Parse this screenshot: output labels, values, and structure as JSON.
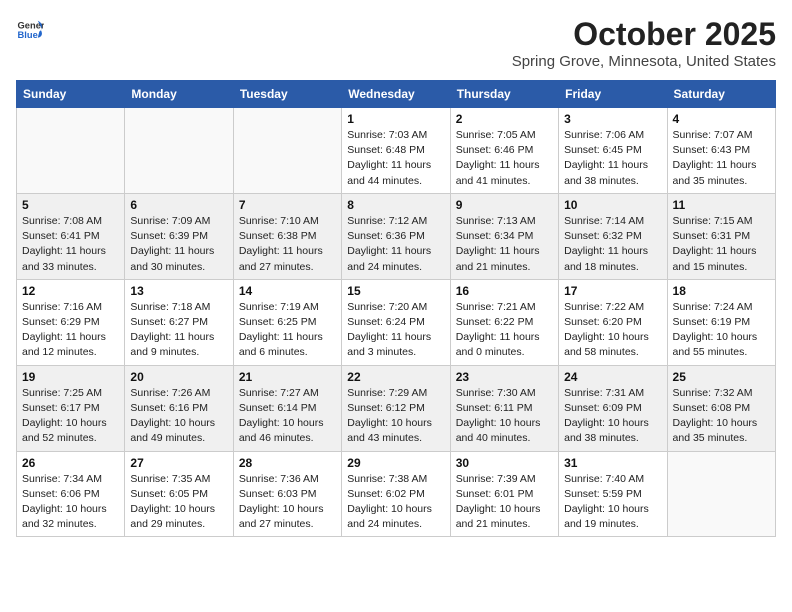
{
  "header": {
    "logo_general": "General",
    "logo_blue": "Blue",
    "month": "October 2025",
    "location": "Spring Grove, Minnesota, United States"
  },
  "weekdays": [
    "Sunday",
    "Monday",
    "Tuesday",
    "Wednesday",
    "Thursday",
    "Friday",
    "Saturday"
  ],
  "weeks": [
    [
      {
        "day": "",
        "info": ""
      },
      {
        "day": "",
        "info": ""
      },
      {
        "day": "",
        "info": ""
      },
      {
        "day": "1",
        "info": "Sunrise: 7:03 AM\nSunset: 6:48 PM\nDaylight: 11 hours\nand 44 minutes."
      },
      {
        "day": "2",
        "info": "Sunrise: 7:05 AM\nSunset: 6:46 PM\nDaylight: 11 hours\nand 41 minutes."
      },
      {
        "day": "3",
        "info": "Sunrise: 7:06 AM\nSunset: 6:45 PM\nDaylight: 11 hours\nand 38 minutes."
      },
      {
        "day": "4",
        "info": "Sunrise: 7:07 AM\nSunset: 6:43 PM\nDaylight: 11 hours\nand 35 minutes."
      }
    ],
    [
      {
        "day": "5",
        "info": "Sunrise: 7:08 AM\nSunset: 6:41 PM\nDaylight: 11 hours\nand 33 minutes."
      },
      {
        "day": "6",
        "info": "Sunrise: 7:09 AM\nSunset: 6:39 PM\nDaylight: 11 hours\nand 30 minutes."
      },
      {
        "day": "7",
        "info": "Sunrise: 7:10 AM\nSunset: 6:38 PM\nDaylight: 11 hours\nand 27 minutes."
      },
      {
        "day": "8",
        "info": "Sunrise: 7:12 AM\nSunset: 6:36 PM\nDaylight: 11 hours\nand 24 minutes."
      },
      {
        "day": "9",
        "info": "Sunrise: 7:13 AM\nSunset: 6:34 PM\nDaylight: 11 hours\nand 21 minutes."
      },
      {
        "day": "10",
        "info": "Sunrise: 7:14 AM\nSunset: 6:32 PM\nDaylight: 11 hours\nand 18 minutes."
      },
      {
        "day": "11",
        "info": "Sunrise: 7:15 AM\nSunset: 6:31 PM\nDaylight: 11 hours\nand 15 minutes."
      }
    ],
    [
      {
        "day": "12",
        "info": "Sunrise: 7:16 AM\nSunset: 6:29 PM\nDaylight: 11 hours\nand 12 minutes."
      },
      {
        "day": "13",
        "info": "Sunrise: 7:18 AM\nSunset: 6:27 PM\nDaylight: 11 hours\nand 9 minutes."
      },
      {
        "day": "14",
        "info": "Sunrise: 7:19 AM\nSunset: 6:25 PM\nDaylight: 11 hours\nand 6 minutes."
      },
      {
        "day": "15",
        "info": "Sunrise: 7:20 AM\nSunset: 6:24 PM\nDaylight: 11 hours\nand 3 minutes."
      },
      {
        "day": "16",
        "info": "Sunrise: 7:21 AM\nSunset: 6:22 PM\nDaylight: 11 hours\nand 0 minutes."
      },
      {
        "day": "17",
        "info": "Sunrise: 7:22 AM\nSunset: 6:20 PM\nDaylight: 10 hours\nand 58 minutes."
      },
      {
        "day": "18",
        "info": "Sunrise: 7:24 AM\nSunset: 6:19 PM\nDaylight: 10 hours\nand 55 minutes."
      }
    ],
    [
      {
        "day": "19",
        "info": "Sunrise: 7:25 AM\nSunset: 6:17 PM\nDaylight: 10 hours\nand 52 minutes."
      },
      {
        "day": "20",
        "info": "Sunrise: 7:26 AM\nSunset: 6:16 PM\nDaylight: 10 hours\nand 49 minutes."
      },
      {
        "day": "21",
        "info": "Sunrise: 7:27 AM\nSunset: 6:14 PM\nDaylight: 10 hours\nand 46 minutes."
      },
      {
        "day": "22",
        "info": "Sunrise: 7:29 AM\nSunset: 6:12 PM\nDaylight: 10 hours\nand 43 minutes."
      },
      {
        "day": "23",
        "info": "Sunrise: 7:30 AM\nSunset: 6:11 PM\nDaylight: 10 hours\nand 40 minutes."
      },
      {
        "day": "24",
        "info": "Sunrise: 7:31 AM\nSunset: 6:09 PM\nDaylight: 10 hours\nand 38 minutes."
      },
      {
        "day": "25",
        "info": "Sunrise: 7:32 AM\nSunset: 6:08 PM\nDaylight: 10 hours\nand 35 minutes."
      }
    ],
    [
      {
        "day": "26",
        "info": "Sunrise: 7:34 AM\nSunset: 6:06 PM\nDaylight: 10 hours\nand 32 minutes."
      },
      {
        "day": "27",
        "info": "Sunrise: 7:35 AM\nSunset: 6:05 PM\nDaylight: 10 hours\nand 29 minutes."
      },
      {
        "day": "28",
        "info": "Sunrise: 7:36 AM\nSunset: 6:03 PM\nDaylight: 10 hours\nand 27 minutes."
      },
      {
        "day": "29",
        "info": "Sunrise: 7:38 AM\nSunset: 6:02 PM\nDaylight: 10 hours\nand 24 minutes."
      },
      {
        "day": "30",
        "info": "Sunrise: 7:39 AM\nSunset: 6:01 PM\nDaylight: 10 hours\nand 21 minutes."
      },
      {
        "day": "31",
        "info": "Sunrise: 7:40 AM\nSunset: 5:59 PM\nDaylight: 10 hours\nand 19 minutes."
      },
      {
        "day": "",
        "info": ""
      }
    ]
  ]
}
